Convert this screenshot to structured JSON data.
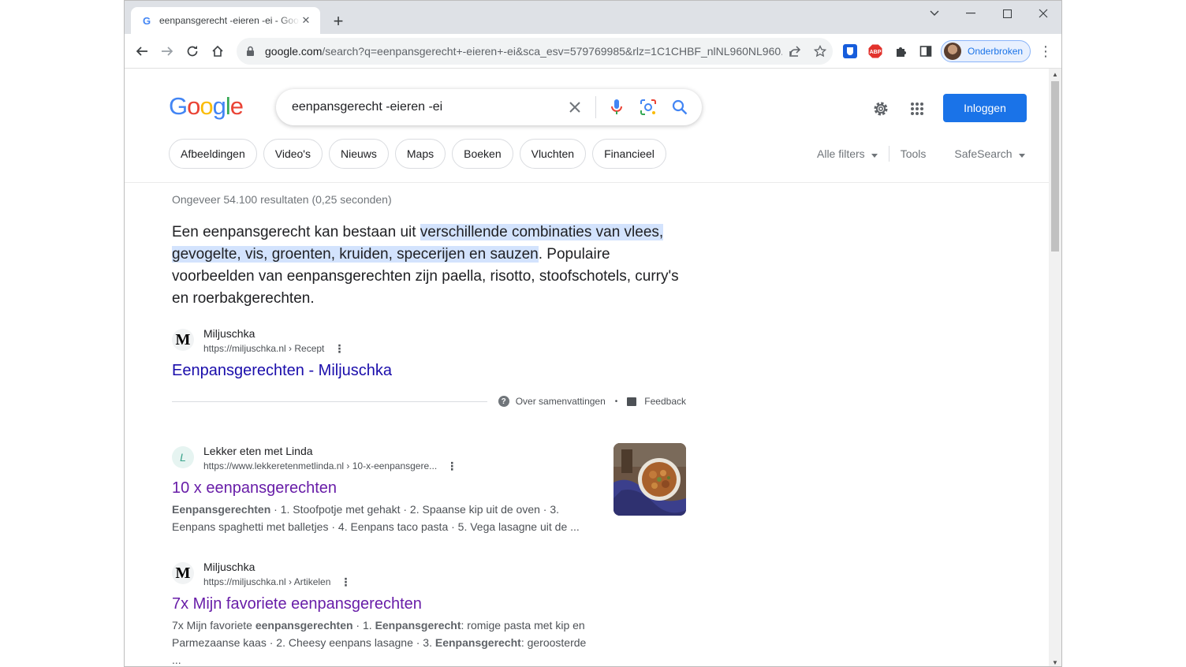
{
  "browser": {
    "tab_title": "eenpansgerecht -eieren -ei - Google Zoeken",
    "tab_favicon": "G",
    "url_host": "google.com",
    "url_path": "/search?q=eenpansgerecht+-eieren+-ei&sca_esv=579769985&rlz=1C1CHBF_nlNL960NL960...",
    "profile_name": "Onderbroken",
    "abp_label": "ABP"
  },
  "google": {
    "logo": "Google",
    "query": "eenpansgerecht -eieren -ei",
    "login_label": "Inloggen",
    "chips": [
      "Afbeeldingen",
      "Video's",
      "Nieuws",
      "Maps",
      "Boeken",
      "Vluchten",
      "Financieel"
    ],
    "filters": {
      "all_filters": "Alle filters",
      "tools": "Tools",
      "safesearch": "SafeSearch"
    },
    "stats": "Ongeveer 54.100 resultaten (0,25 seconden)",
    "snippet": {
      "pre": "Een eenpansgerecht kan bestaan uit ",
      "highlight": "verschillende combinaties van vlees, gevogelte, vis, groenten, kruiden, specerijen en sauzen",
      "post": ". Populaire voorbeelden van eenpansgerechten zijn paella, risotto, stoofschotels, curry's en roerbakgerechten."
    },
    "featured_source": {
      "favicon": "M",
      "name": "Miljuschka",
      "cite": "https://miljuschka.nl › Recept",
      "title": "Eenpansgerechten - Miljuschka"
    },
    "about": {
      "about_label": "Over samenvattingen",
      "feedback_label": "Feedback"
    },
    "results": [
      {
        "favicon": "L",
        "name": "Lekker eten met Linda",
        "cite": "https://www.lekkeretenmetlinda.nl › 10-x-eenpansgere...",
        "title": "10 x eenpansgerechten",
        "desc_bold": "Eenpansgerechten",
        "desc_line1": " · 1. Stoofpotje met gehakt · 2. Spaanse kip uit de oven · 3.",
        "desc_line2": "Eenpans spaghetti met balletjes · 4. Eenpans taco pasta · 5. Vega lasagne uit de ..."
      },
      {
        "favicon": "M",
        "name": "Miljuschka",
        "cite": "https://miljuschka.nl › Artikelen",
        "title": "7x Mijn favoriete eenpansgerechten",
        "desc_a": "7x Mijn favoriete ",
        "desc_b": "eenpansgerechten",
        "desc_c": " · 1. ",
        "desc_d": "Eenpansgerecht",
        "desc_e": ": romige pasta met kip en",
        "desc_f": "Parmezaanse kaas · 2. Cheesy eenpans lasagne · 3. ",
        "desc_g": "Eenpansgerecht",
        "desc_h": ": geroosterde ..."
      }
    ]
  },
  "colors": {
    "link": "#1a0dab",
    "visited": "#681da8",
    "accent": "#1a73e8",
    "highlight": "#d3e3fd"
  }
}
